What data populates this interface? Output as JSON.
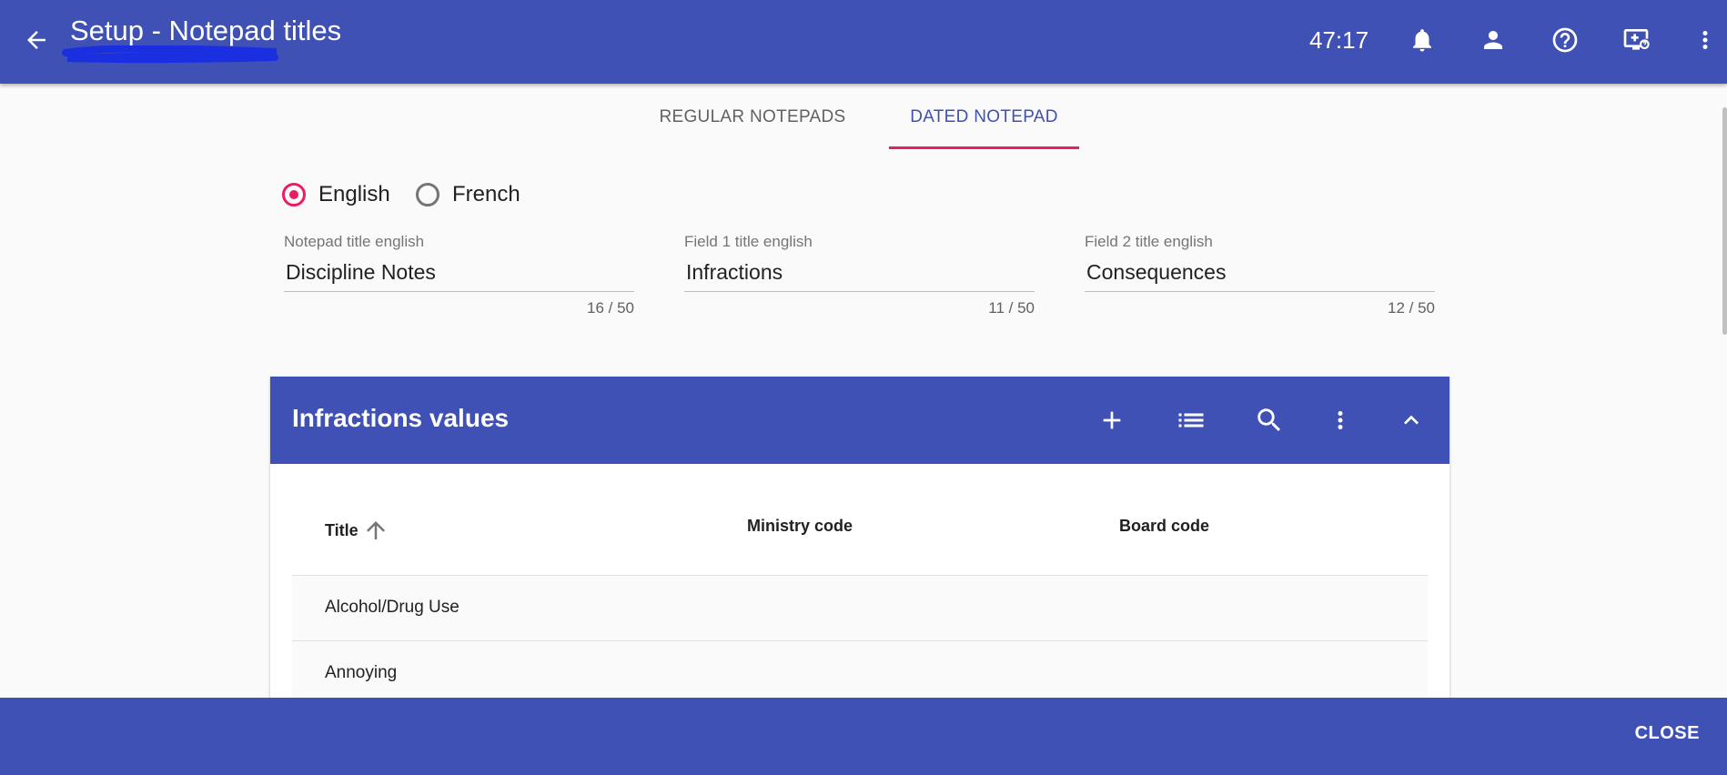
{
  "appbar": {
    "title": "Setup - Notepad titles",
    "timer": "47:17",
    "icons": [
      "back-arrow-icon",
      "bell-icon",
      "person-icon",
      "help-icon",
      "screen-share-icon",
      "more-vert-icon"
    ]
  },
  "tabs": [
    {
      "label": "REGULAR NOTEPADS",
      "active": false
    },
    {
      "label": "DATED NOTEPAD",
      "active": true
    }
  ],
  "language": {
    "options": [
      {
        "label": "English",
        "checked": true
      },
      {
        "label": "French",
        "checked": false
      }
    ]
  },
  "fields": [
    {
      "label": "Notepad title english",
      "value": "Discipline Notes",
      "count": "16 / 50"
    },
    {
      "label": "Field 1 title english",
      "value": "Infractions",
      "count": "11 / 50"
    },
    {
      "label": "Field 2 title english",
      "value": "Consequences",
      "count": "12 / 50"
    }
  ],
  "card": {
    "title": "Infractions values",
    "icons": [
      "add-icon",
      "list-icon",
      "search-icon",
      "more-vert-icon",
      "chevron-up-icon"
    ],
    "columns": [
      "Title",
      "Ministry code",
      "Board code"
    ],
    "rows": [
      {
        "title": "Alcohol/Drug Use"
      },
      {
        "title": "Annoying"
      }
    ]
  },
  "footer": {
    "close_label": "CLOSE"
  },
  "colors": {
    "primary": "#3f51b5",
    "accent": "#e91e63"
  }
}
